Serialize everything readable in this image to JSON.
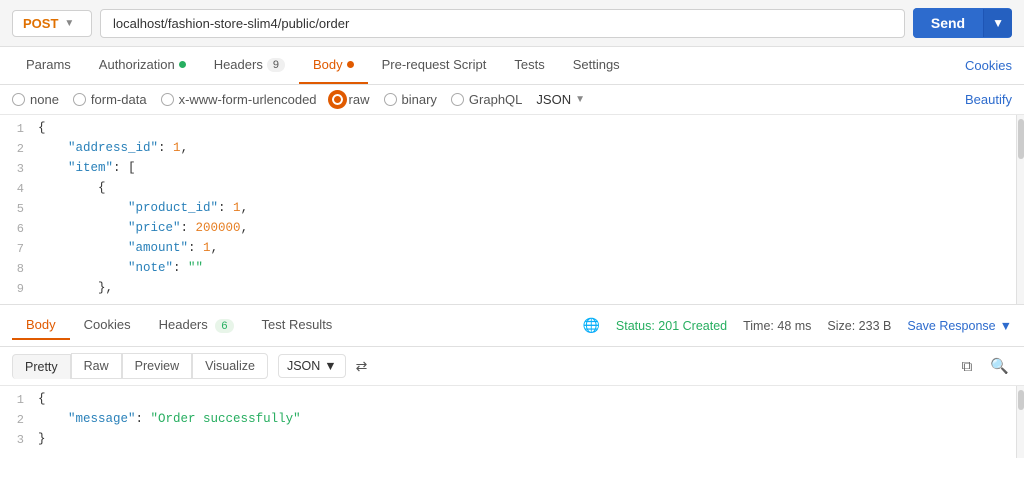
{
  "method": "POST",
  "url": "localhost/fashion-store-slim4/public/order",
  "tabs": [
    {
      "label": "Params",
      "dot": null,
      "badge": null,
      "active": false
    },
    {
      "label": "Authorization",
      "dot": "green",
      "badge": null,
      "active": false
    },
    {
      "label": "Headers",
      "dot": null,
      "badge": "9",
      "active": false
    },
    {
      "label": "Body",
      "dot": "orange",
      "badge": null,
      "active": true
    },
    {
      "label": "Pre-request Script",
      "dot": null,
      "badge": null,
      "active": false
    },
    {
      "label": "Tests",
      "dot": null,
      "badge": null,
      "active": false
    },
    {
      "label": "Settings",
      "dot": null,
      "badge": null,
      "active": false
    }
  ],
  "cookies_link": "Cookies",
  "body_options": [
    {
      "label": "none",
      "selected": false
    },
    {
      "label": "form-data",
      "selected": false
    },
    {
      "label": "x-www-form-urlencoded",
      "selected": false
    },
    {
      "label": "raw",
      "selected": true,
      "color": "orange"
    },
    {
      "label": "binary",
      "selected": false
    },
    {
      "label": "GraphQL",
      "selected": false
    }
  ],
  "json_format": "JSON",
  "beautify_label": "Beautify",
  "request_body": [
    {
      "line": 1,
      "content": "{"
    },
    {
      "line": 2,
      "content": "  \"address_id\": 1,"
    },
    {
      "line": 3,
      "content": "  \"item\": ["
    },
    {
      "line": 4,
      "content": "    {"
    },
    {
      "line": 5,
      "content": "      \"product_id\": 1,"
    },
    {
      "line": 6,
      "content": "      \"price\": 200000,"
    },
    {
      "line": 7,
      "content": "      \"amount\": 1,"
    },
    {
      "line": 8,
      "content": "      \"note\": \"\""
    },
    {
      "line": 9,
      "content": "    },"
    }
  ],
  "response": {
    "tabs": [
      {
        "label": "Body",
        "active": true
      },
      {
        "label": "Cookies",
        "active": false
      },
      {
        "label": "Headers",
        "badge": "6",
        "active": false
      },
      {
        "label": "Test Results",
        "active": false
      }
    ],
    "status": "Status: 201 Created",
    "time": "Time: 48 ms",
    "size": "Size: 233 B",
    "save_response": "Save Response",
    "format_tabs": [
      {
        "label": "Pretty",
        "active": true
      },
      {
        "label": "Raw",
        "active": false
      },
      {
        "label": "Preview",
        "active": false
      },
      {
        "label": "Visualize",
        "active": false
      }
    ],
    "json_format": "JSON",
    "body_lines": [
      {
        "line": 1,
        "content": "{"
      },
      {
        "line": 2,
        "content": "  \"message\": \"Order successfully\""
      },
      {
        "line": 3,
        "content": "}"
      }
    ]
  },
  "send_btn": "Send"
}
